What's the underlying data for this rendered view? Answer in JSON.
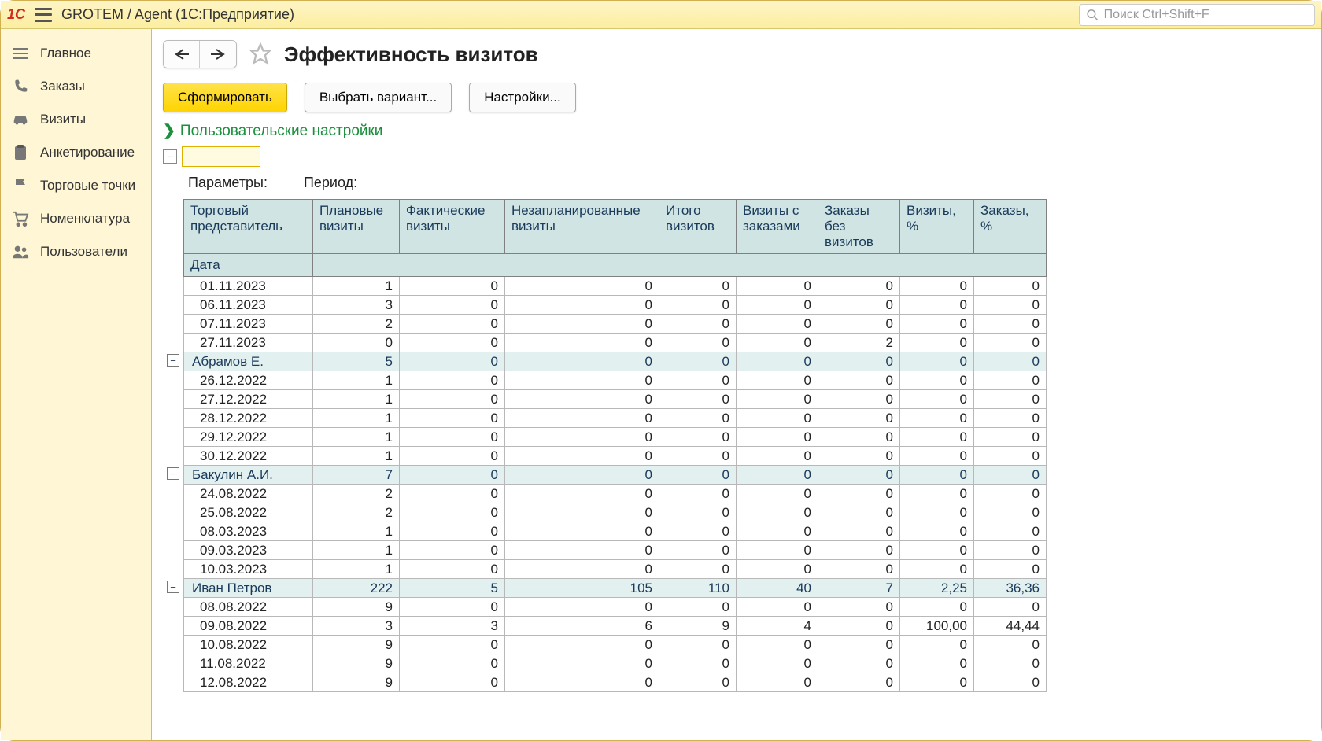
{
  "titlebar": {
    "app_title": "GROTEM / Agent  (1С:Предприятие)",
    "search_placeholder": "Поиск Ctrl+Shift+F"
  },
  "sidebar": {
    "items": [
      {
        "icon": "lines-icon",
        "label": "Главное"
      },
      {
        "icon": "phone-icon",
        "label": "Заказы"
      },
      {
        "icon": "car-icon",
        "label": "Визиты"
      },
      {
        "icon": "clipboard-icon",
        "label": "Анкетирование"
      },
      {
        "icon": "flag-icon",
        "label": "Торговые точки"
      },
      {
        "icon": "cart-icon",
        "label": "Номенклатура"
      },
      {
        "icon": "users-icon",
        "label": "Пользователи"
      }
    ]
  },
  "page": {
    "title": "Эффективность визитов",
    "btn_generate": "Сформировать",
    "btn_variant": "Выбрать вариант...",
    "btn_settings": "Настройки...",
    "user_settings_label": "Пользовательские настройки",
    "params_label": "Параметры:",
    "period_label": "Период:"
  },
  "table": {
    "headers": {
      "rep": "Торговый представитель",
      "plan": "Плановые визиты",
      "fact": "Фактические визиты",
      "unplan": "Незапланированные визиты",
      "total": "Итого визитов",
      "vorders": "Визиты с заказами",
      "onovisit": "Заказы без визитов",
      "vpct": "Визиты, %",
      "opct": "Заказы, %",
      "date": "Дата"
    },
    "rows": [
      {
        "type": "data",
        "label": "01.11.2023",
        "v": [
          "1",
          "0",
          "0",
          "0",
          "0",
          "0",
          "0",
          "0"
        ]
      },
      {
        "type": "data",
        "label": "06.11.2023",
        "v": [
          "3",
          "0",
          "0",
          "0",
          "0",
          "0",
          "0",
          "0"
        ]
      },
      {
        "type": "data",
        "label": "07.11.2023",
        "v": [
          "2",
          "0",
          "0",
          "0",
          "0",
          "0",
          "0",
          "0"
        ]
      },
      {
        "type": "data",
        "label": "27.11.2023",
        "v": [
          "0",
          "0",
          "0",
          "0",
          "0",
          "2",
          "0",
          "0"
        ]
      },
      {
        "type": "group",
        "label": "Абрамов Е.",
        "v": [
          "5",
          "0",
          "0",
          "0",
          "0",
          "0",
          "0",
          "0"
        ]
      },
      {
        "type": "data",
        "label": "26.12.2022",
        "v": [
          "1",
          "0",
          "0",
          "0",
          "0",
          "0",
          "0",
          "0"
        ]
      },
      {
        "type": "data",
        "label": "27.12.2022",
        "v": [
          "1",
          "0",
          "0",
          "0",
          "0",
          "0",
          "0",
          "0"
        ]
      },
      {
        "type": "data",
        "label": "28.12.2022",
        "v": [
          "1",
          "0",
          "0",
          "0",
          "0",
          "0",
          "0",
          "0"
        ]
      },
      {
        "type": "data",
        "label": "29.12.2022",
        "v": [
          "1",
          "0",
          "0",
          "0",
          "0",
          "0",
          "0",
          "0"
        ]
      },
      {
        "type": "data",
        "label": "30.12.2022",
        "v": [
          "1",
          "0",
          "0",
          "0",
          "0",
          "0",
          "0",
          "0"
        ]
      },
      {
        "type": "group",
        "label": "Бакулин А.И.",
        "v": [
          "7",
          "0",
          "0",
          "0",
          "0",
          "0",
          "0",
          "0"
        ]
      },
      {
        "type": "data",
        "label": "24.08.2022",
        "v": [
          "2",
          "0",
          "0",
          "0",
          "0",
          "0",
          "0",
          "0"
        ]
      },
      {
        "type": "data",
        "label": "25.08.2022",
        "v": [
          "2",
          "0",
          "0",
          "0",
          "0",
          "0",
          "0",
          "0"
        ]
      },
      {
        "type": "data",
        "label": "08.03.2023",
        "v": [
          "1",
          "0",
          "0",
          "0",
          "0",
          "0",
          "0",
          "0"
        ]
      },
      {
        "type": "data",
        "label": "09.03.2023",
        "v": [
          "1",
          "0",
          "0",
          "0",
          "0",
          "0",
          "0",
          "0"
        ]
      },
      {
        "type": "data",
        "label": "10.03.2023",
        "v": [
          "1",
          "0",
          "0",
          "0",
          "0",
          "0",
          "0",
          "0"
        ]
      },
      {
        "type": "group",
        "label": "Иван Петров",
        "v": [
          "222",
          "5",
          "105",
          "110",
          "40",
          "7",
          "2,25",
          "36,36"
        ]
      },
      {
        "type": "data",
        "label": "08.08.2022",
        "v": [
          "9",
          "0",
          "0",
          "0",
          "0",
          "0",
          "0",
          "0"
        ]
      },
      {
        "type": "data",
        "label": "09.08.2022",
        "v": [
          "3",
          "3",
          "6",
          "9",
          "4",
          "0",
          "100,00",
          "44,44"
        ]
      },
      {
        "type": "data",
        "label": "10.08.2022",
        "v": [
          "9",
          "0",
          "0",
          "0",
          "0",
          "0",
          "0",
          "0"
        ]
      },
      {
        "type": "data",
        "label": "11.08.2022",
        "v": [
          "9",
          "0",
          "0",
          "0",
          "0",
          "0",
          "0",
          "0"
        ]
      },
      {
        "type": "data",
        "label": "12.08.2022",
        "v": [
          "9",
          "0",
          "0",
          "0",
          "0",
          "0",
          "0",
          "0"
        ]
      }
    ]
  }
}
